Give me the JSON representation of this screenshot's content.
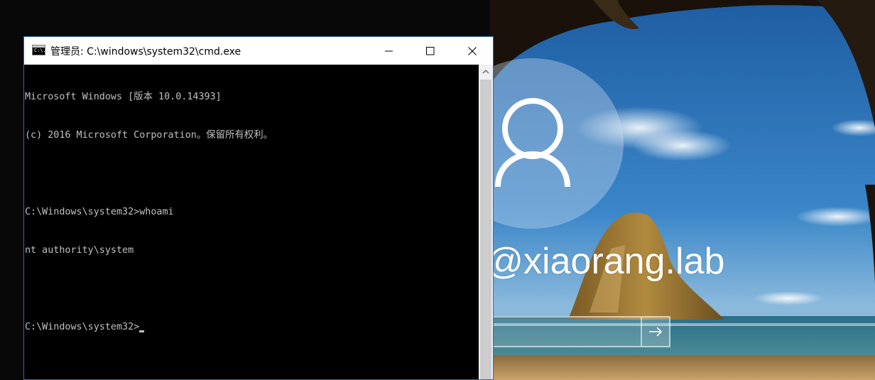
{
  "lockscreen": {
    "username": "ldrich@xiaorang.lab",
    "password_value": "",
    "icons": {
      "avatar": "user-icon",
      "submit": "arrow-right-icon"
    }
  },
  "cmd": {
    "title": "管理员: C:\\windows\\system32\\cmd.exe",
    "icon_text": "C:\\.",
    "lines": [
      "Microsoft Windows [版本 10.0.14393]",
      "(c) 2016 Microsoft Corporation。保留所有权利。",
      "",
      "C:\\Windows\\system32>whoami",
      "nt authority\\system",
      "",
      "C:\\Windows\\system32>"
    ],
    "icons": {
      "minimize": "minimize-icon",
      "maximize": "maximize-icon",
      "close": "close-icon",
      "scroll_up": "chevron-up-icon"
    }
  },
  "colors": {
    "console_bg": "#000000",
    "console_text": "#c0c0c0",
    "window_border": "#2c6bbd"
  }
}
